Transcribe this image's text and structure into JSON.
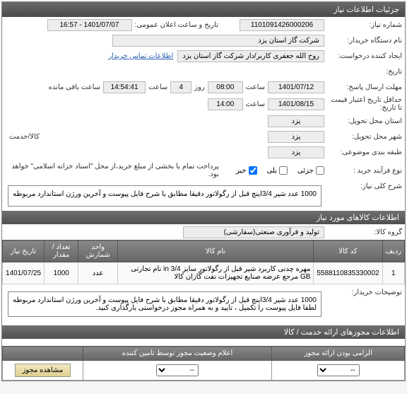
{
  "header": {
    "title": "جزئیات اطلاعات نیاز"
  },
  "fields": {
    "need_no_label": "شماره نیاز:",
    "need_no": "1101091426000206",
    "announce_label": "تاریخ و ساعت اعلان عمومی:",
    "announce_value": "1401/07/07 - 16:57",
    "buyer_label": "نام دستگاه خریدار:",
    "buyer_value": "شرکت گاز استان یزد",
    "requester_label": "ایجاد کننده درخواست:",
    "requester_value": "روح الله جعفری کاربر/دار شرکت گاز استان یزد",
    "contact_link": "اطلاعات تماس خریدار",
    "date_label": "تاریخ:",
    "send_deadline_label": "مهلت ارسال پاسخ:",
    "send_deadline_date": "1401/07/12",
    "hour_label": "ساعت",
    "send_deadline_hour": "08:00",
    "day_label": "روز",
    "days_value": "4",
    "remain_time_label": "ساعت باقی مانده",
    "remain_time": "14:54:41",
    "validity_label": "حداقل تاریخ اعتبار قیمت تا تاریخ:",
    "validity_date": "1401/08/15",
    "validity_hour": "14:00",
    "province_label": "استان محل تحویل:",
    "province_value": "یزد",
    "city_label": "شهر محل تحویل:",
    "city_value": "یزد",
    "storage_label": "طبقه بندی موضوعی:",
    "storage_value": "یزد",
    "service_label": "کالا/خدمت",
    "process_label": "نوع فرآیند خرید :",
    "payment_note": "پرداخت تمام یا بخشی از مبلغ خرید،از محل \"اسناد خزانه اسلامی\" خواهد بود.",
    "options": {
      "partial": "جزئی",
      "yes": "بلی",
      "no": "خیر"
    }
  },
  "desc": {
    "label": "شرح کلی نیاز:",
    "text": "1000 عدد شیر 3/4اینچ قبل از رگولاتور دقیقا مطابق با شرح فایل پیوست و آخرین ورژن استاندارد مربوطه"
  },
  "items_section": {
    "title": "اطلاعات کالاهای مورد نیاز",
    "group_label": "گروه کالا:",
    "group_value": "تولید و فرآوری صنعتی(سفارشی)"
  },
  "table": {
    "headers": {
      "row": "ردیف",
      "code": "کد کالا",
      "name": "نام کالا",
      "unit": "واحد شمارش",
      "qty": "تعداد / مقدار",
      "date": "تاریخ نیاز"
    },
    "rows": [
      {
        "idx": "1",
        "code": "5588110835330002",
        "name_line": "مهره چدنی کاربرد شیر قبل از رگولاتور سایز 3/4 in نام تجارتی GB مرجع عرضه صنایع تجهیزات نفت گازان کالا",
        "unit": "عدد",
        "qty": "1000",
        "date": "1401/07/25"
      }
    ]
  },
  "buyer_notes": {
    "label": "توضیحات خریدار:",
    "text": "1000 عدد شیر 3/4اینچ قبل از رگولاتور دقیقا مطابق با شرح فایل پیوست و آخرین ورژن استاندارد مربوطه لطفا فایل پیوست را تکمیل ، تایید و به همراه مجوز درخواستی بارگذاری کنید."
  },
  "permits": {
    "title": "اطلاعات مجوزهای ارائه خدمت / کالا",
    "mandatory_label": "الزامی بودن ارائه مجوز",
    "status_label": "اعلام وضعیت مجوز توسط تامین کننده",
    "view_btn": "مشاهده مجوز",
    "select_placeholder": "--"
  }
}
